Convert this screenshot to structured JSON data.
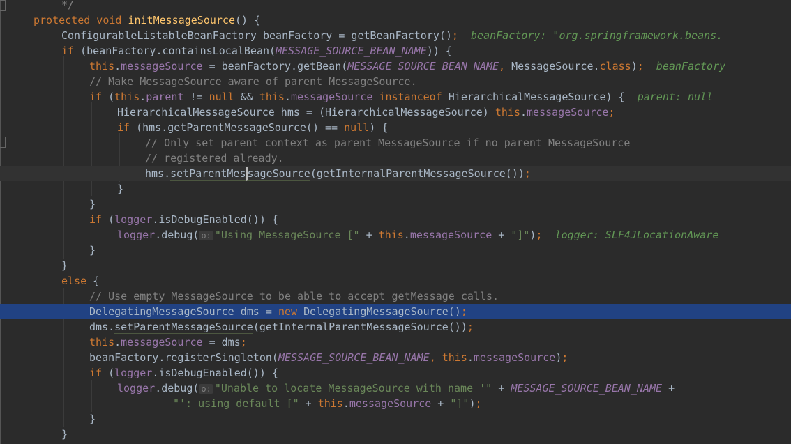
{
  "editor": {
    "lines": [
      [
        [
          "cm",
          "*/"
        ]
      ],
      [
        [
          "kw",
          "protected void "
        ],
        [
          "fn",
          "initMessageSource"
        ],
        [
          "p",
          "() {"
        ]
      ],
      [
        [
          "p",
          "ConfigurableListableBeanFactory beanFactory = getBeanFactory()"
        ],
        [
          "kw",
          ";"
        ],
        [
          "inline",
          "  beanFactory: \"org.springframework.beans."
        ]
      ],
      [
        [
          "kw",
          "if "
        ],
        [
          "p",
          "(beanFactory.containsLocalBean("
        ],
        [
          "cst",
          "MESSAGE_SOURCE_BEAN_NAME"
        ],
        [
          "p",
          ")) {"
        ]
      ],
      [
        [
          "kw",
          "this"
        ],
        [
          "p",
          "."
        ],
        [
          "field",
          "messageSource"
        ],
        [
          "p",
          " = beanFactory.getBean("
        ],
        [
          "cst",
          "MESSAGE_SOURCE_BEAN_NAME"
        ],
        [
          "kw",
          ", "
        ],
        [
          "p",
          "MessageSource."
        ],
        [
          "kw",
          "class"
        ],
        [
          "p",
          ")"
        ],
        [
          "kw",
          ";"
        ],
        [
          "inline",
          "  beanFactory"
        ]
      ],
      [
        [
          "cm",
          "// Make MessageSource aware of parent MessageSource."
        ]
      ],
      [
        [
          "kw",
          "if "
        ],
        [
          "p",
          "("
        ],
        [
          "kw",
          "this"
        ],
        [
          "p",
          "."
        ],
        [
          "field",
          "parent"
        ],
        [
          "p",
          " != "
        ],
        [
          "kw",
          "null "
        ],
        [
          "p",
          "&& "
        ],
        [
          "kw",
          "this"
        ],
        [
          "p",
          "."
        ],
        [
          "field",
          "messageSource "
        ],
        [
          "kw",
          "instanceof "
        ],
        [
          "p",
          "HierarchicalMessageSource) {"
        ],
        [
          "inline",
          "  parent: null"
        ]
      ],
      [
        [
          "p",
          "HierarchicalMessageSource hms = (HierarchicalMessageSource) "
        ],
        [
          "kw",
          "this"
        ],
        [
          "p",
          "."
        ],
        [
          "field",
          "messageSource"
        ],
        [
          "kw",
          ";"
        ]
      ],
      [
        [
          "kw",
          "if "
        ],
        [
          "p",
          "(hms.getParentMessageSource() == "
        ],
        [
          "kw",
          "null"
        ],
        [
          "p",
          ") {"
        ]
      ],
      [
        [
          "cm",
          "// Only set parent context as parent MessageSource if no parent MessageSource"
        ]
      ],
      [
        [
          "cm",
          "// registered already."
        ]
      ],
      [
        [
          "p",
          "hms."
        ],
        [
          "ul",
          "setParentMes"
        ],
        [
          "caret",
          "sageSource"
        ],
        [
          "p",
          "(getInternalParentMessageSource())"
        ],
        [
          "kw",
          ";"
        ]
      ],
      [
        [
          "p",
          "}"
        ]
      ],
      [
        [
          "p",
          "}"
        ]
      ],
      [
        [
          "kw",
          "if "
        ],
        [
          "p",
          "("
        ],
        [
          "field",
          "logger"
        ],
        [
          "p",
          ".isDebugEnabled()) {"
        ]
      ],
      [
        [
          "field",
          "logger"
        ],
        [
          "p",
          ".debug("
        ],
        [
          "hint",
          "o:"
        ],
        [
          "str",
          "\"Using MessageSource [\""
        ],
        [
          "p",
          " + "
        ],
        [
          "kw",
          "this"
        ],
        [
          "p",
          "."
        ],
        [
          "field",
          "messageSource"
        ],
        [
          "p",
          " + "
        ],
        [
          "str",
          "\"]\""
        ],
        [
          "p",
          ")"
        ],
        [
          "kw",
          ";"
        ],
        [
          "inline",
          "  logger: SLF4JLocationAware"
        ]
      ],
      [
        [
          "p",
          "}"
        ]
      ],
      [
        [
          "p",
          "}"
        ]
      ],
      [
        [
          "kw",
          "else "
        ],
        [
          "p",
          "{"
        ]
      ],
      [
        [
          "cm",
          "// Use empty MessageSource to be able to accept getMessage calls."
        ]
      ],
      [
        [
          "p",
          "DelegatingMessageSource dms = "
        ],
        [
          "kw",
          "new "
        ],
        [
          "p",
          "DelegatingMessageSource()"
        ],
        [
          "kw",
          ";"
        ]
      ],
      [
        [
          "p",
          "dms."
        ],
        [
          "ul",
          "setParentMessageSource"
        ],
        [
          "p",
          "(getInternalParentMessageSource())"
        ],
        [
          "kw",
          ";"
        ]
      ],
      [
        [
          "kw",
          "this"
        ],
        [
          "p",
          "."
        ],
        [
          "field",
          "messageSource"
        ],
        [
          "p",
          " = dms"
        ],
        [
          "kw",
          ";"
        ]
      ],
      [
        [
          "p",
          "beanFactory.registerSingleton("
        ],
        [
          "cst",
          "MESSAGE_SOURCE_BEAN_NAME"
        ],
        [
          "kw",
          ", this"
        ],
        [
          "p",
          "."
        ],
        [
          "field",
          "messageSource"
        ],
        [
          "p",
          ")"
        ],
        [
          "kw",
          ";"
        ]
      ],
      [
        [
          "kw",
          "if "
        ],
        [
          "p",
          "("
        ],
        [
          "field",
          "logger"
        ],
        [
          "p",
          ".isDebugEnabled()) {"
        ]
      ],
      [
        [
          "field",
          "logger"
        ],
        [
          "p",
          ".debug("
        ],
        [
          "hint",
          "o:"
        ],
        [
          "str",
          "\"Unable to locate MessageSource with name '\""
        ],
        [
          "p",
          " + "
        ],
        [
          "cst",
          "MESSAGE_SOURCE_BEAN_NAME"
        ],
        [
          "p",
          " +"
        ]
      ],
      [
        [
          "str",
          "\"': using default [\""
        ],
        [
          "p",
          " + "
        ],
        [
          "kw",
          "this"
        ],
        [
          "p",
          "."
        ],
        [
          "field",
          "messageSource"
        ],
        [
          "p",
          " + "
        ],
        [
          "str",
          "\"]\""
        ],
        [
          "p",
          ")"
        ],
        [
          "kw",
          ";"
        ]
      ],
      [
        [
          "p",
          "}"
        ]
      ],
      [
        [
          "p",
          "}"
        ]
      ]
    ]
  },
  "colors": {
    "background": "#2b2b2b",
    "highlight": "#214283",
    "keyword": "#cc7832",
    "method": "#ffc66d",
    "field": "#9876aa",
    "comment": "#808080",
    "string": "#6a8759"
  }
}
